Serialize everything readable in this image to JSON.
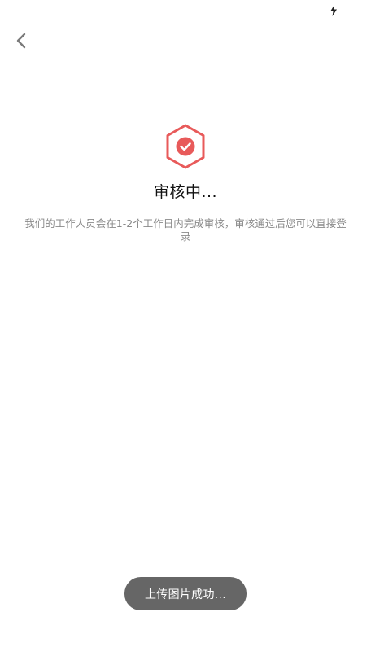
{
  "status_bar": {
    "icon": "charging-bolt-icon"
  },
  "nav": {
    "back_icon": "chevron-left-icon"
  },
  "review": {
    "badge_icon": "hexagon-check-icon",
    "title": "审核中...",
    "description": "我们的工作人员会在1-2个工作日内完成审核，审核通过后您可以直接登录"
  },
  "toast": {
    "message": "上传图片成功..."
  },
  "colors": {
    "accent": "#e85a5a",
    "toast_bg": "#666666",
    "description_text": "#8a8a8a"
  }
}
